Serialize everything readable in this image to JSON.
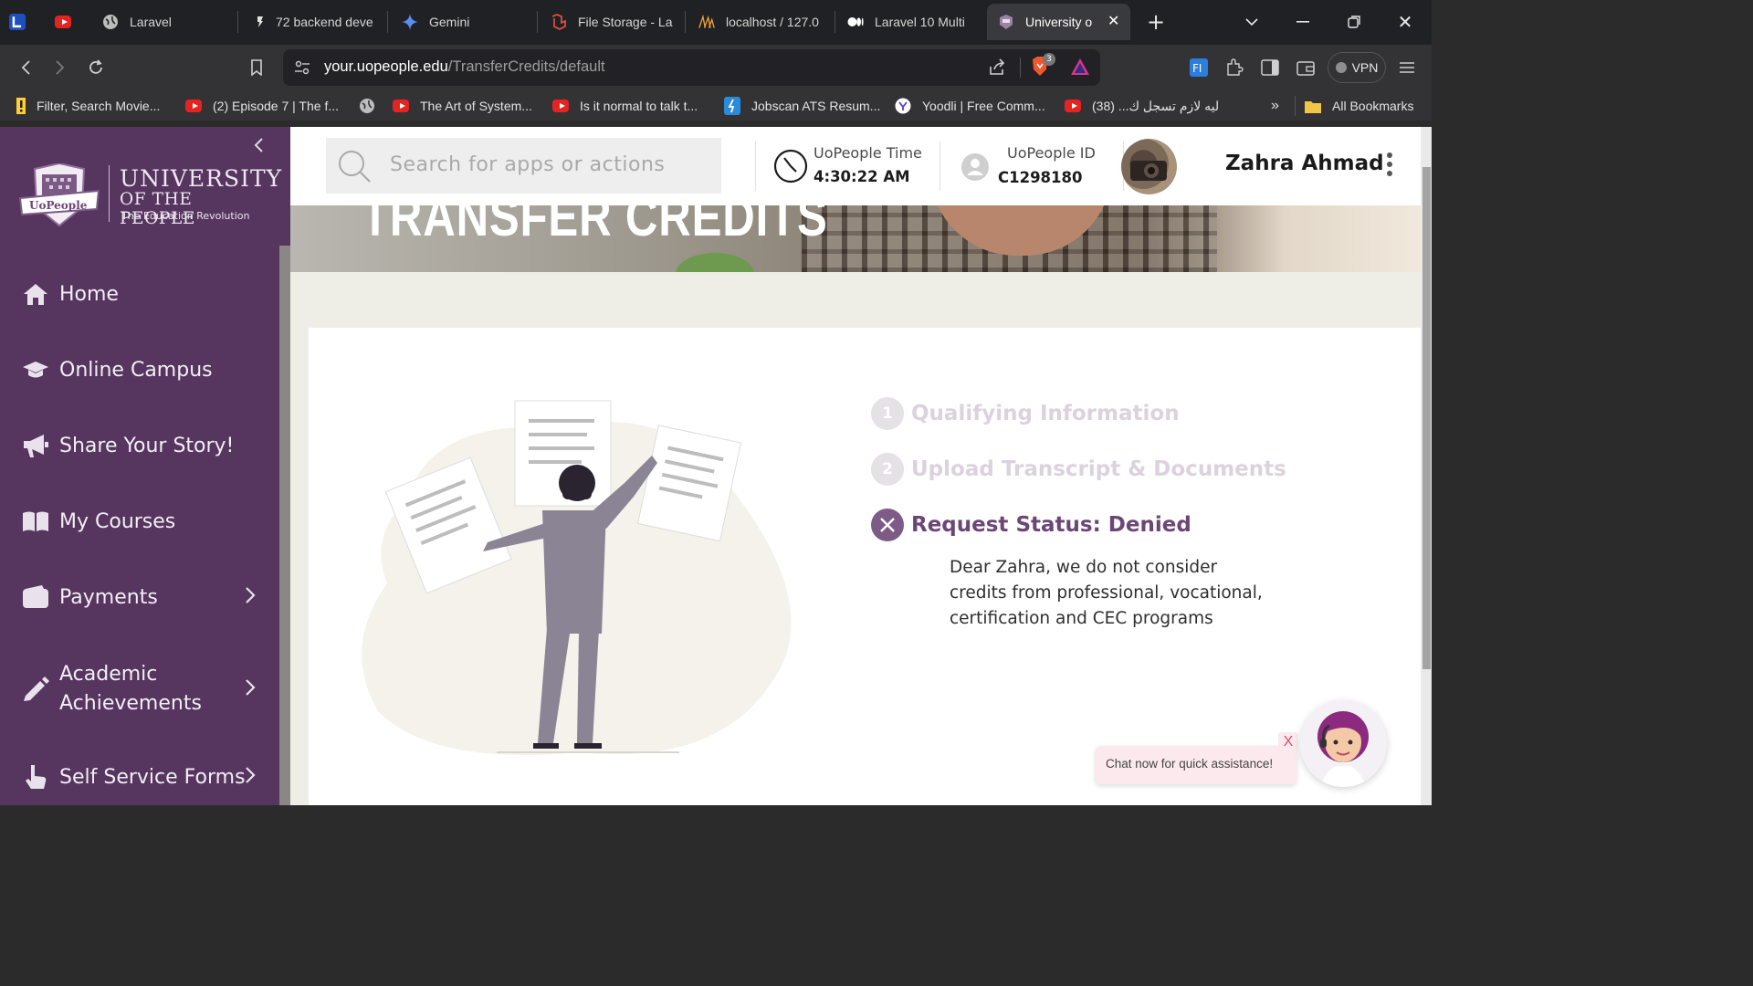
{
  "browser": {
    "tabs": [
      {
        "title": "",
        "icon": "app-logo-icon"
      },
      {
        "title": "",
        "icon": "youtube-icon"
      },
      {
        "title": "Laravel",
        "icon": "globe-icon"
      },
      {
        "title": "72 backend deve",
        "icon": "page-icon"
      },
      {
        "title": "Gemini",
        "icon": "gemini-icon"
      },
      {
        "title": "File Storage - La",
        "icon": "laravel-icon"
      },
      {
        "title": "localhost / 127.0",
        "icon": "phpmyadmin-icon"
      },
      {
        "title": "Laravel 10 Multi",
        "icon": "medium-icon"
      },
      {
        "title": "University o",
        "icon": "uopeople-icon"
      }
    ],
    "active_tab_index": 8,
    "url_host": "your.uopeople.edu",
    "url_path": "/TransferCredits/default",
    "brave_badge": "3",
    "vpn_label": "VPN",
    "bookmarks": [
      {
        "label": "Filter, Search Movie...",
        "icon": "exclamation-icon"
      },
      {
        "label": "(2) Episode 7 | The f...",
        "icon": "youtube-icon"
      },
      {
        "label": "",
        "icon": "globe-icon"
      },
      {
        "label": "The Art of System...",
        "icon": "youtube-icon"
      },
      {
        "label": "Is it normal to talk t...",
        "icon": "youtube-icon"
      },
      {
        "label": "Jobscan ATS Resum...",
        "icon": "jobscan-icon"
      },
      {
        "label": "Yoodli | Free Comm...",
        "icon": "yoodli-icon"
      },
      {
        "label": "ليه لازم تسجل ك... (38)",
        "icon": "youtube-icon"
      }
    ],
    "all_bookmarks_label": "All Bookmarks",
    "overflow_label": "»"
  },
  "sidebar": {
    "logo_line1": "UNIVERSITY",
    "logo_line2": "OF THE PEOPLE",
    "logo_tagline": "The Education Revolution",
    "logo_badge": "UoPeople",
    "items": [
      {
        "label": "Home",
        "icon": "home-icon",
        "has_chevron": false
      },
      {
        "label": "Online Campus",
        "icon": "graduation-cap-icon",
        "has_chevron": false
      },
      {
        "label": "Share Your Story!",
        "icon": "megaphone-icon",
        "has_chevron": false
      },
      {
        "label": "My Courses",
        "icon": "book-icon",
        "has_chevron": false
      },
      {
        "label": "Payments",
        "icon": "wallet-icon",
        "has_chevron": true
      },
      {
        "label": "Academic\nAchievements",
        "icon": "pencil-icon",
        "has_chevron": true
      },
      {
        "label": "Self Service Forms",
        "icon": "hand-pointer-icon",
        "has_chevron": true
      }
    ]
  },
  "header": {
    "search_placeholder": "Search for apps or actions",
    "time_label": "UoPeople Time",
    "time_value": "4:30:22 AM",
    "id_label": "UoPeople ID",
    "id_value": "C1298180",
    "user_name": "Zahra Ahmad"
  },
  "banner": {
    "title": "TRANSFER CREDITS"
  },
  "steps": [
    {
      "number": "1",
      "label": "Qualifying Information",
      "state": "inactive"
    },
    {
      "number": "2",
      "label": "Upload Transcript & Documents",
      "state": "inactive"
    },
    {
      "number": "",
      "label": "Request Status: Denied",
      "state": "denied"
    }
  ],
  "status_message": "Dear Zahra, we do not consider credits from professional, vocational, certification and CEC programs",
  "chat": {
    "prompt": "Chat now for quick assistance!",
    "close_label": "X"
  },
  "colors": {
    "sidebar_bg": "#56355f",
    "accent_purple": "#6c4677",
    "inactive_step": "#dcd2de",
    "page_bg": "#efeee6"
  }
}
